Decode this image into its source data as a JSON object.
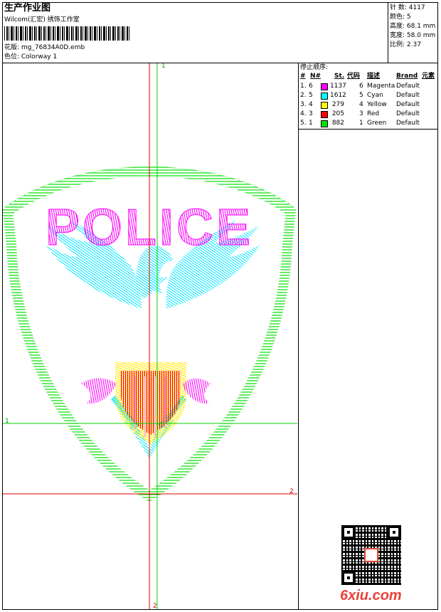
{
  "header": {
    "title": "生产作业图",
    "company": "Wilcom(汇宏) 绣饰工作室",
    "design_label": "花版: mg_76834A0D.emb",
    "colorway_label": "色位: Colorway 1"
  },
  "stats": {
    "stitches": "针 数: 4117",
    "colors": "颜色: 5",
    "height": "高度: 68.1 mm",
    "width": "宽度: 58.0 mm",
    "scale": "比例: 2.37"
  },
  "stop_sequence": {
    "label": "停止顺序:",
    "headers": [
      "#",
      "N#",
      "St.",
      "代码",
      "描述",
      "Brand",
      "元素"
    ],
    "rows": [
      {
        "num": "1.",
        "n": "6",
        "stitches": "1137",
        "code": "6",
        "desc": "Magenta",
        "brand": "Default",
        "color": "#ff00ff"
      },
      {
        "num": "2.",
        "n": "5",
        "stitches": "1612",
        "code": "5",
        "desc": "Cyan",
        "brand": "Default",
        "color": "#00ffff"
      },
      {
        "num": "3.",
        "n": "4",
        "stitches": "279",
        "code": "4",
        "desc": "Yellow",
        "brand": "Default",
        "color": "#ffff00"
      },
      {
        "num": "4.",
        "n": "3",
        "stitches": "205",
        "code": "3",
        "desc": "Red",
        "brand": "Default",
        "color": "#ff0000"
      },
      {
        "num": "5.",
        "n": "1",
        "stitches": "882",
        "code": "1",
        "desc": "Green",
        "brand": "Default",
        "color": "#00e000"
      }
    ]
  },
  "design": {
    "text": "POLICE",
    "guide_labels": {
      "top": "1",
      "left": "1",
      "right": "2",
      "bottom": "2"
    }
  },
  "watermark": "6xiu.com"
}
